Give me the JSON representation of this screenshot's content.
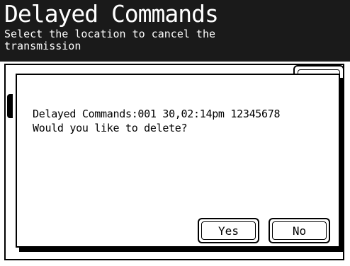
{
  "header": {
    "title": "Delayed Commands",
    "instruction": "Select the location to cancel the\ntransmission"
  },
  "dialog": {
    "message_line1": "Delayed Commands:001 30,02:14pm 12345678",
    "message_line2": "Would you like to delete?",
    "yes_label": "Yes",
    "no_label": "No"
  }
}
